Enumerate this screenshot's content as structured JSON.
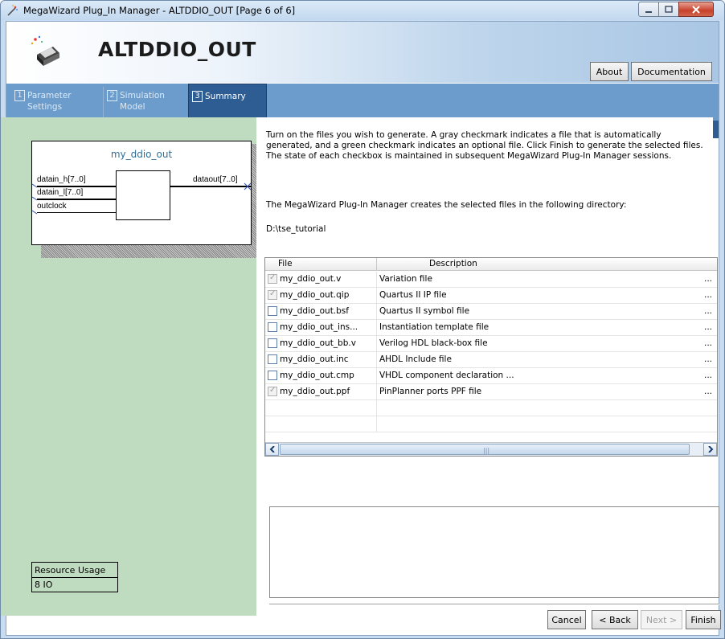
{
  "window": {
    "title": "MegaWizard Plug_In Manager - ALTDDIO_OUT [Page 6 of 6]",
    "minimize_icon": "minimize-icon",
    "maximize_icon": "maximize-icon",
    "close_icon": "close-icon"
  },
  "header": {
    "title": "ALTDDIO_OUT",
    "about_label": "About",
    "documentation_label": "Documentation"
  },
  "tabs": [
    {
      "num": "1",
      "label": "Parameter\nSettings"
    },
    {
      "num": "2",
      "label": "Simulation\nModel"
    },
    {
      "num": "3",
      "label": "Summary"
    }
  ],
  "symbol": {
    "name": "my_ddio_out",
    "pins": {
      "in1": "datain_h[7..0]",
      "in2": "datain_l[7..0]",
      "in3": "outclock",
      "out1": "dataout[7..0]"
    }
  },
  "resource": {
    "header": "Resource Usage",
    "value": "8 IO"
  },
  "summary": {
    "instructions": "Turn on the files you wish to generate. A gray checkmark indicates a file that is automatically generated, and a green checkmark indicates an optional file. Click Finish to generate the selected files. The state of each checkbox is maintained in subsequent MegaWizard Plug-In Manager sessions.",
    "directory_note": "The MegaWizard Plug-In Manager creates the selected files in the following directory:",
    "directory": "D:\\tse_tutorial"
  },
  "files_table": {
    "col_file": "File",
    "col_description": "Description",
    "rows": [
      {
        "file": "my_ddio_out.v",
        "description": "Variation file",
        "more": "...",
        "checked": true
      },
      {
        "file": "my_ddio_out.qip",
        "description": "Quartus II IP file",
        "more": "...",
        "checked": true
      },
      {
        "file": "my_ddio_out.bsf",
        "description": "Quartus II symbol file",
        "more": "...",
        "checked": false
      },
      {
        "file": "my_ddio_out_ins...",
        "description": "Instantiation template file",
        "more": "...",
        "checked": false
      },
      {
        "file": "my_ddio_out_bb.v",
        "description": "Verilog HDL black-box file",
        "more": "...",
        "checked": false
      },
      {
        "file": "my_ddio_out.inc",
        "description": "AHDL Include file",
        "more": "...",
        "checked": false
      },
      {
        "file": "my_ddio_out.cmp",
        "description": "VHDL component declaration ...",
        "more": "...",
        "checked": false
      },
      {
        "file": "my_ddio_out.ppf",
        "description": "PinPlanner ports PPF file",
        "more": "...",
        "checked": true
      }
    ]
  },
  "footer": {
    "cancel_label": "Cancel",
    "back_label": "< Back",
    "next_label": "Next >",
    "finish_label": "Finish"
  }
}
